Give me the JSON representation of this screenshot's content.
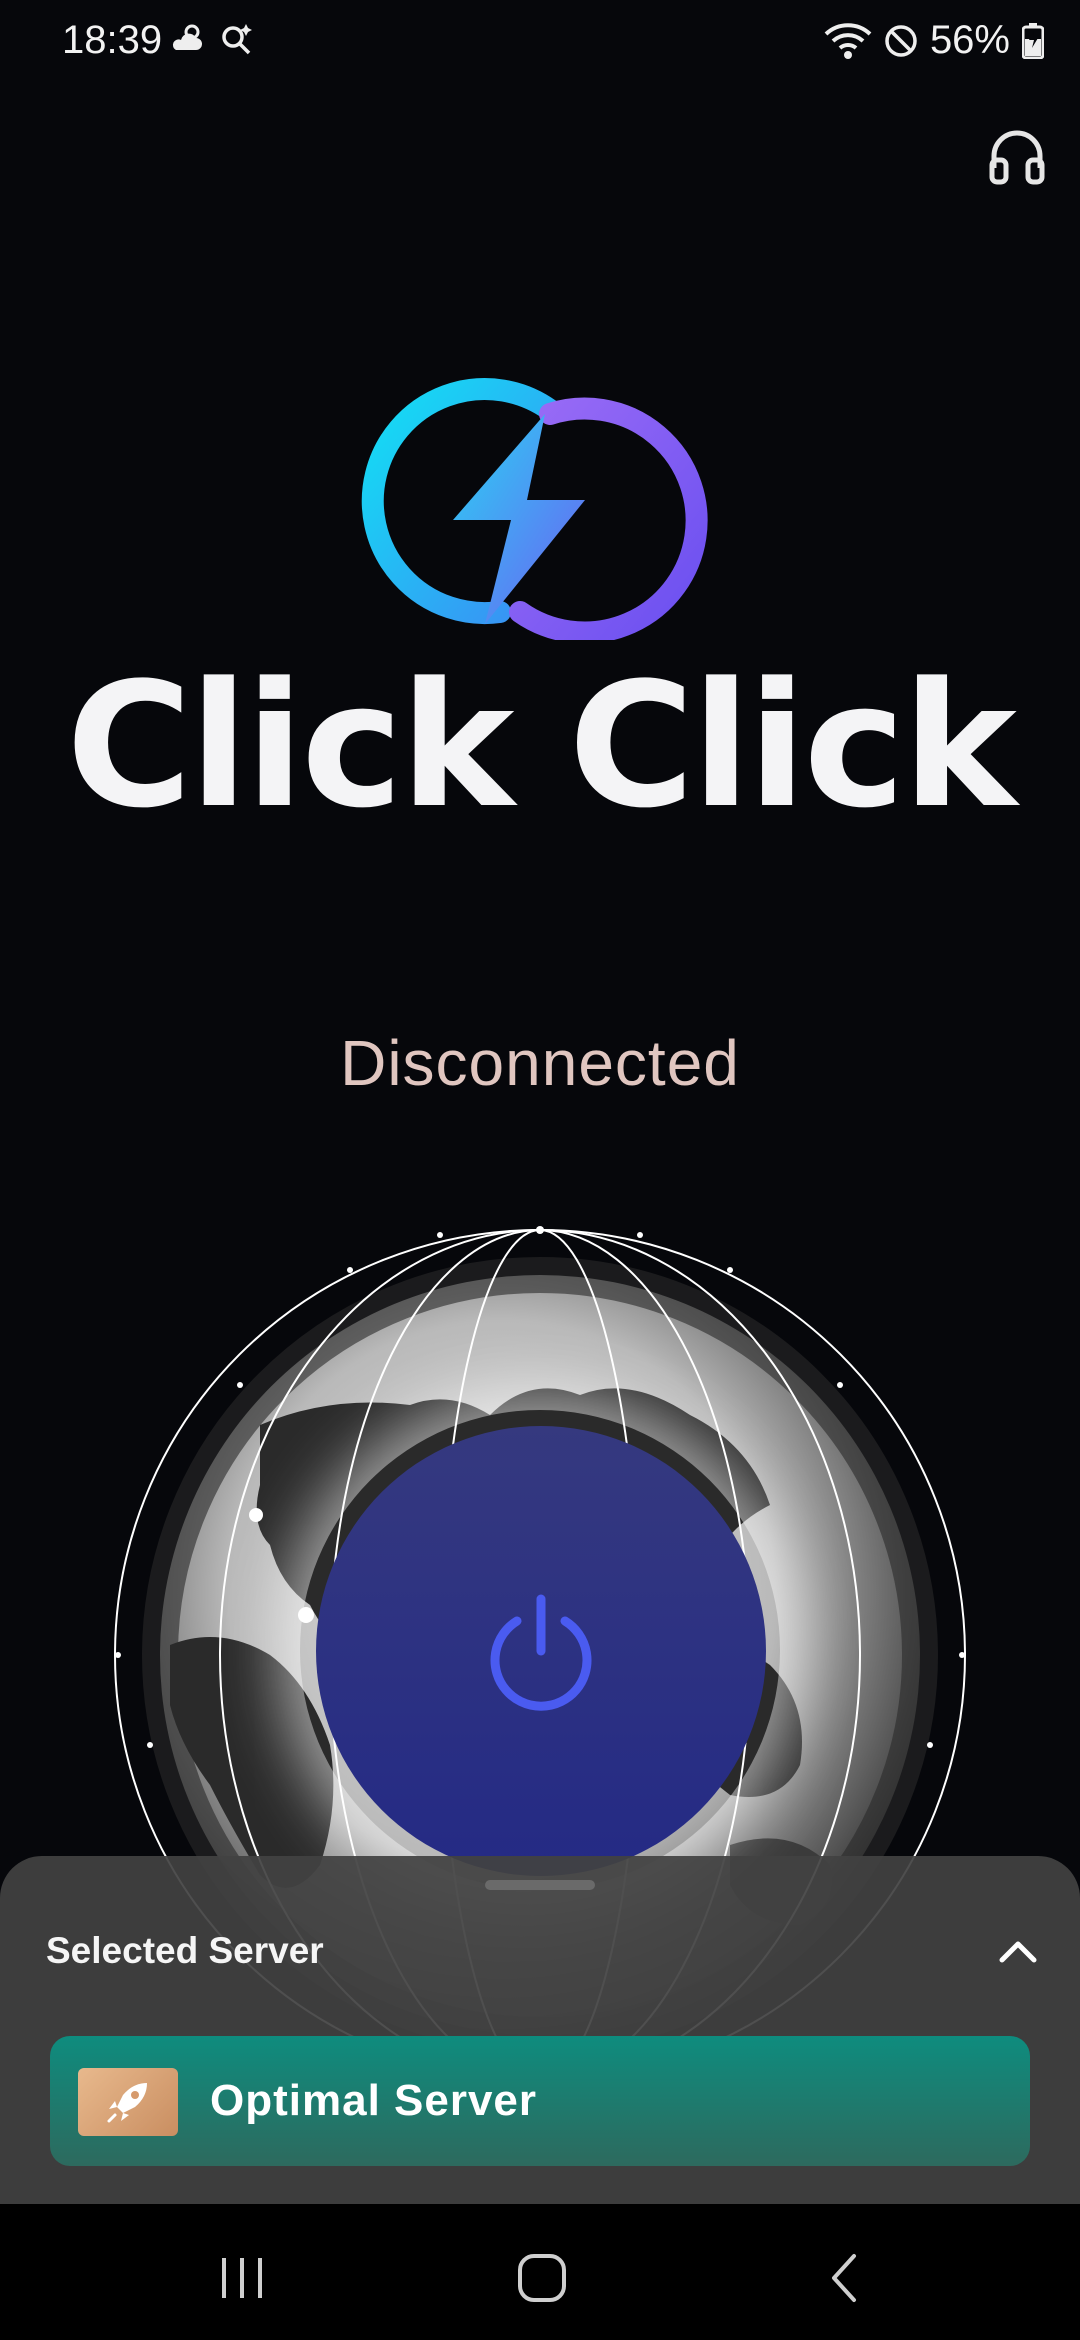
{
  "status_bar": {
    "time": "18:39",
    "battery": "56%"
  },
  "app": {
    "name": "Click Click"
  },
  "connection": {
    "status": "Disconnected"
  },
  "sheet": {
    "title": "Selected Server",
    "server_name": "Optimal Server"
  },
  "colors": {
    "accent_cyan": "#19d6f0",
    "accent_purple": "#8a63f2",
    "button_blue": "#2c3182",
    "server_green": "#0e8c7e"
  },
  "icons": [
    "weather-icon",
    "search-icon",
    "wifi-icon",
    "dnd-icon",
    "battery-icon",
    "headset-icon",
    "power-icon",
    "chevron-up-icon",
    "rocket-icon",
    "recents-icon",
    "home-icon",
    "back-icon"
  ]
}
